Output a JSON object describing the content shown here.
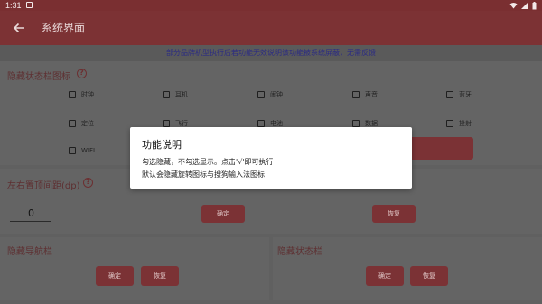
{
  "status_bar": {
    "time": "1:31"
  },
  "app_bar": {
    "title": "系统界面"
  },
  "notice": "部分品牌机型执行后若功能无效说明该功能被系统屏蔽，无需反馈",
  "hide_status_icons": {
    "title": "隐藏状态栏图标",
    "items": [
      "时钟",
      "耳机",
      "闹钟",
      "声音",
      "蓝牙",
      "定位",
      "飞行",
      "电池",
      "数据",
      "投射",
      "WIFI"
    ]
  },
  "margin_section": {
    "title": "左右置顶间距(dp)",
    "value": "0",
    "confirm_label": "确定",
    "restore_label": "恢复"
  },
  "nav_bar_section": {
    "title": "隐藏导航栏",
    "confirm_label": "确定",
    "restore_label": "恢复"
  },
  "status_bar_section": {
    "title": "隐藏状态栏",
    "confirm_label": "确定",
    "restore_label": "恢复"
  },
  "dialog": {
    "title": "功能说明",
    "line1": "勾选隐藏，不勾选显示。点击'√'即可执行",
    "line2": "默认会隐藏旋转图标与搜狗输入法图标"
  },
  "colors": {
    "primary": "#7c3234",
    "scrim": "#606060",
    "dialog_bg": "#ffffff"
  }
}
